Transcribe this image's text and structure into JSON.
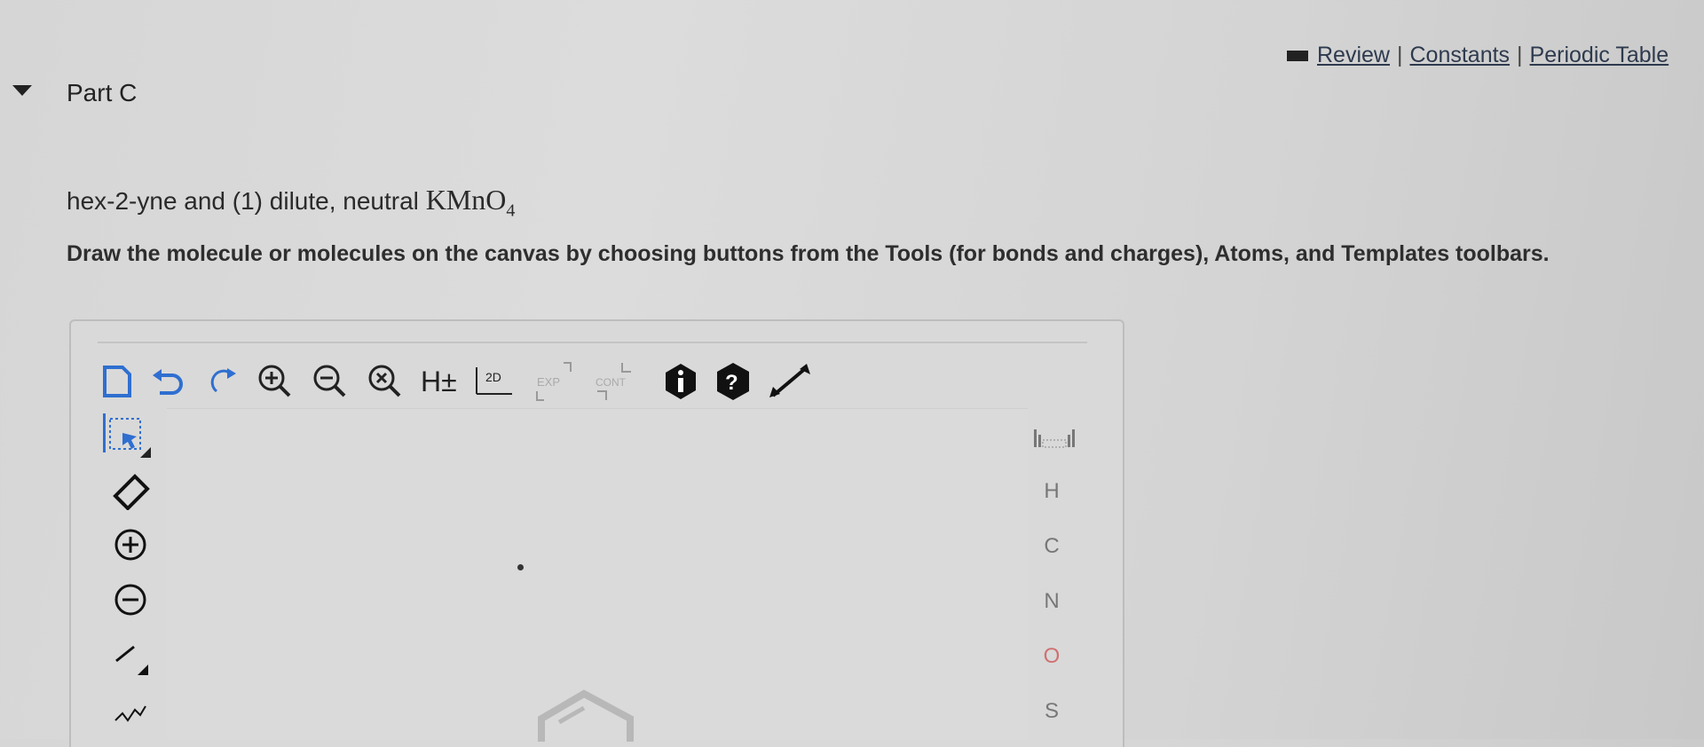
{
  "header": {
    "links": [
      "Review",
      "Constants",
      "Periodic Table"
    ],
    "separator": "|"
  },
  "part": {
    "title": "Part C"
  },
  "question": {
    "text": "hex-2-yne and (1) dilute, neutral ",
    "reagent_main": "KMnO",
    "reagent_sub": "4"
  },
  "instructions": "Draw the molecule or molecules on the canvas by choosing buttons from the Tools (for bonds and charges), Atoms, and Templates toolbars.",
  "toolbar": {
    "items": [
      {
        "name": "new-document-icon"
      },
      {
        "name": "undo-icon"
      },
      {
        "name": "redo-icon"
      },
      {
        "name": "zoom-in-icon"
      },
      {
        "name": "zoom-out-icon"
      },
      {
        "name": "zoom-reset-icon"
      },
      {
        "name": "hydrogen-toggle-icon",
        "label": "H±"
      },
      {
        "name": "clean-2d-icon",
        "label": "2D"
      },
      {
        "name": "expand-icon",
        "label": "EXP"
      },
      {
        "name": "contract-icon",
        "label": "CONT"
      },
      {
        "name": "info-icon"
      },
      {
        "name": "help-icon"
      },
      {
        "name": "fullscreen-icon"
      }
    ]
  },
  "left_tools": [
    {
      "name": "select-tool-icon"
    },
    {
      "name": "eraser-tool-icon"
    },
    {
      "name": "positive-charge-tool-icon"
    },
    {
      "name": "negative-charge-tool-icon"
    },
    {
      "name": "single-bond-tool-icon"
    },
    {
      "name": "chain-tool-icon"
    }
  ],
  "atoms": [
    "H",
    "C",
    "N",
    "O",
    "S"
  ],
  "colors": {
    "accent_blue": "#2f6fd0",
    "oxygen": "#d07070",
    "icon_dark": "#222222"
  }
}
